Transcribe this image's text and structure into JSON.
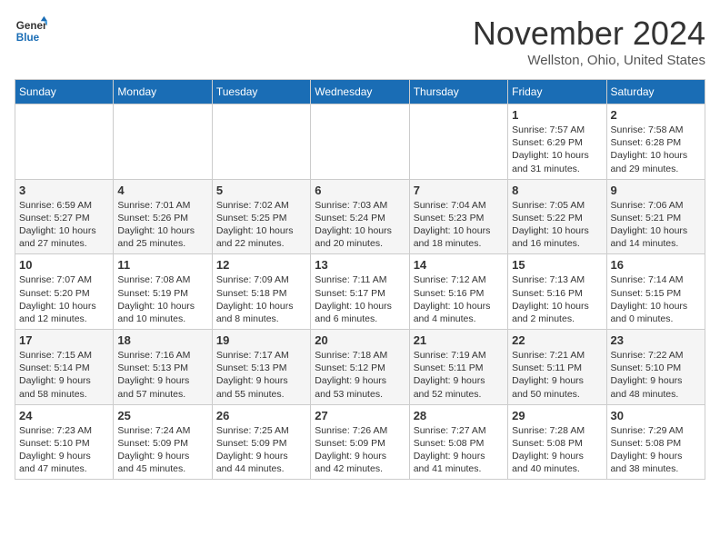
{
  "logo": {
    "line1": "General",
    "line2": "Blue"
  },
  "title": "November 2024",
  "subtitle": "Wellston, Ohio, United States",
  "days_header": [
    "Sunday",
    "Monday",
    "Tuesday",
    "Wednesday",
    "Thursday",
    "Friday",
    "Saturday"
  ],
  "weeks": [
    [
      {
        "day": "",
        "info": ""
      },
      {
        "day": "",
        "info": ""
      },
      {
        "day": "",
        "info": ""
      },
      {
        "day": "",
        "info": ""
      },
      {
        "day": "",
        "info": ""
      },
      {
        "day": "1",
        "info": "Sunrise: 7:57 AM\nSunset: 6:29 PM\nDaylight: 10 hours\nand 31 minutes."
      },
      {
        "day": "2",
        "info": "Sunrise: 7:58 AM\nSunset: 6:28 PM\nDaylight: 10 hours\nand 29 minutes."
      }
    ],
    [
      {
        "day": "3",
        "info": "Sunrise: 6:59 AM\nSunset: 5:27 PM\nDaylight: 10 hours\nand 27 minutes."
      },
      {
        "day": "4",
        "info": "Sunrise: 7:01 AM\nSunset: 5:26 PM\nDaylight: 10 hours\nand 25 minutes."
      },
      {
        "day": "5",
        "info": "Sunrise: 7:02 AM\nSunset: 5:25 PM\nDaylight: 10 hours\nand 22 minutes."
      },
      {
        "day": "6",
        "info": "Sunrise: 7:03 AM\nSunset: 5:24 PM\nDaylight: 10 hours\nand 20 minutes."
      },
      {
        "day": "7",
        "info": "Sunrise: 7:04 AM\nSunset: 5:23 PM\nDaylight: 10 hours\nand 18 minutes."
      },
      {
        "day": "8",
        "info": "Sunrise: 7:05 AM\nSunset: 5:22 PM\nDaylight: 10 hours\nand 16 minutes."
      },
      {
        "day": "9",
        "info": "Sunrise: 7:06 AM\nSunset: 5:21 PM\nDaylight: 10 hours\nand 14 minutes."
      }
    ],
    [
      {
        "day": "10",
        "info": "Sunrise: 7:07 AM\nSunset: 5:20 PM\nDaylight: 10 hours\nand 12 minutes."
      },
      {
        "day": "11",
        "info": "Sunrise: 7:08 AM\nSunset: 5:19 PM\nDaylight: 10 hours\nand 10 minutes."
      },
      {
        "day": "12",
        "info": "Sunrise: 7:09 AM\nSunset: 5:18 PM\nDaylight: 10 hours\nand 8 minutes."
      },
      {
        "day": "13",
        "info": "Sunrise: 7:11 AM\nSunset: 5:17 PM\nDaylight: 10 hours\nand 6 minutes."
      },
      {
        "day": "14",
        "info": "Sunrise: 7:12 AM\nSunset: 5:16 PM\nDaylight: 10 hours\nand 4 minutes."
      },
      {
        "day": "15",
        "info": "Sunrise: 7:13 AM\nSunset: 5:16 PM\nDaylight: 10 hours\nand 2 minutes."
      },
      {
        "day": "16",
        "info": "Sunrise: 7:14 AM\nSunset: 5:15 PM\nDaylight: 10 hours\nand 0 minutes."
      }
    ],
    [
      {
        "day": "17",
        "info": "Sunrise: 7:15 AM\nSunset: 5:14 PM\nDaylight: 9 hours\nand 58 minutes."
      },
      {
        "day": "18",
        "info": "Sunrise: 7:16 AM\nSunset: 5:13 PM\nDaylight: 9 hours\nand 57 minutes."
      },
      {
        "day": "19",
        "info": "Sunrise: 7:17 AM\nSunset: 5:13 PM\nDaylight: 9 hours\nand 55 minutes."
      },
      {
        "day": "20",
        "info": "Sunrise: 7:18 AM\nSunset: 5:12 PM\nDaylight: 9 hours\nand 53 minutes."
      },
      {
        "day": "21",
        "info": "Sunrise: 7:19 AM\nSunset: 5:11 PM\nDaylight: 9 hours\nand 52 minutes."
      },
      {
        "day": "22",
        "info": "Sunrise: 7:21 AM\nSunset: 5:11 PM\nDaylight: 9 hours\nand 50 minutes."
      },
      {
        "day": "23",
        "info": "Sunrise: 7:22 AM\nSunset: 5:10 PM\nDaylight: 9 hours\nand 48 minutes."
      }
    ],
    [
      {
        "day": "24",
        "info": "Sunrise: 7:23 AM\nSunset: 5:10 PM\nDaylight: 9 hours\nand 47 minutes."
      },
      {
        "day": "25",
        "info": "Sunrise: 7:24 AM\nSunset: 5:09 PM\nDaylight: 9 hours\nand 45 minutes."
      },
      {
        "day": "26",
        "info": "Sunrise: 7:25 AM\nSunset: 5:09 PM\nDaylight: 9 hours\nand 44 minutes."
      },
      {
        "day": "27",
        "info": "Sunrise: 7:26 AM\nSunset: 5:09 PM\nDaylight: 9 hours\nand 42 minutes."
      },
      {
        "day": "28",
        "info": "Sunrise: 7:27 AM\nSunset: 5:08 PM\nDaylight: 9 hours\nand 41 minutes."
      },
      {
        "day": "29",
        "info": "Sunrise: 7:28 AM\nSunset: 5:08 PM\nDaylight: 9 hours\nand 40 minutes."
      },
      {
        "day": "30",
        "info": "Sunrise: 7:29 AM\nSunset: 5:08 PM\nDaylight: 9 hours\nand 38 minutes."
      }
    ]
  ]
}
